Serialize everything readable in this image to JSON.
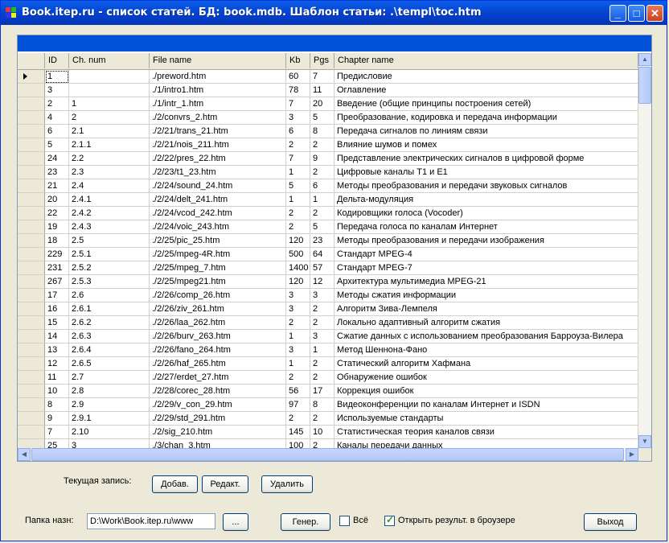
{
  "window": {
    "title": "Book.itep.ru - список статей.   БД: book.mdb.   Шаблон статьи: .\\templ\\toc.htm",
    "controls": {
      "minimize": "_",
      "maximize": "□",
      "close": "✕"
    }
  },
  "grid": {
    "columns": [
      "ID",
      "Ch. num",
      "File name",
      "Kb",
      "Pgs",
      "Chapter name"
    ],
    "rows": [
      [
        "1",
        "",
        "./preword.htm",
        "60",
        "7",
        "Предисловие"
      ],
      [
        "3",
        "",
        "./1/intro1.htm",
        "78",
        "11",
        "Оглавление"
      ],
      [
        "2",
        "1",
        "./1/intr_1.htm",
        "7",
        "20",
        "Введение (общие принципы построения сетей)"
      ],
      [
        "4",
        "2",
        "./2/convrs_2.htm",
        "3",
        "5",
        "Преобразование, кодировка и передача информации"
      ],
      [
        "6",
        "2.1",
        "./2/21/trans_21.htm",
        "6",
        "8",
        "Передача сигналов по линиям связи"
      ],
      [
        "5",
        "2.1.1",
        "./2/21/nois_211.htm",
        "2",
        "2",
        "Влияние шумов и помех"
      ],
      [
        "24",
        "2.2",
        "./2/22/pres_22.htm",
        "7",
        "9",
        "Представление электрических сигналов в цифровой форме"
      ],
      [
        "23",
        "2.3",
        "./2/23/t1_23.htm",
        "1",
        "2",
        "Цифровые каналы T1 и E1"
      ],
      [
        "21",
        "2.4",
        "./2/24/sound_24.htm",
        "5",
        "6",
        "Методы    преобразования и передачи звуковых сигналов"
      ],
      [
        "20",
        "2.4.1",
        "./2/24/delt_241.htm",
        "1",
        "1",
        "Дельта-модуляция"
      ],
      [
        "22",
        "2.4.2",
        "./2/24/vcod_242.htm",
        "2",
        "2",
        "Кодировщики голоса (Vocoder)"
      ],
      [
        "19",
        "2.4.3",
        "./2/24/voic_243.htm",
        "2",
        "5",
        "Передача голоса по каналам Интернет"
      ],
      [
        "18",
        "2.5",
        "./2/25/pic_25.htm",
        "120",
        "23",
        "Методы преобразования и передачи изображения"
      ],
      [
        "229",
        "2.5.1",
        "./2/25/mpeg-4R.htm",
        "500",
        "64",
        "Стандарт MPEG-4"
      ],
      [
        "231",
        "2.5.2",
        "./2/25/mpeg_7.htm",
        "1400",
        "57",
        "Стандарт MPEG-7"
      ],
      [
        "267",
        "2.5.3",
        "./2/25/mpeg21.htm",
        "120",
        "12",
        "Архитектура мультимедиа MPEG-21"
      ],
      [
        "17",
        "2.6",
        "./2/26/comp_26.htm",
        "3",
        "3",
        "Методы сжатия информации"
      ],
      [
        "16",
        "2.6.1",
        "./2/26/ziv_261.htm",
        "3",
        "2",
        "Алгоритм Зива-Лемпеля"
      ],
      [
        "15",
        "2.6.2",
        "./2/26/laa_262.htm",
        "2",
        "2",
        "Локально адаптивный алгоритм сжатия"
      ],
      [
        "14",
        "2.6.3",
        "./2/26/burv_263.htm",
        "1",
        "3",
        "Сжатие данных с использованием  преобразования Барроуза-Вилера"
      ],
      [
        "13",
        "2.6.4",
        "./2/26/fano_264.htm",
        "3",
        "1",
        "Метод Шеннона-Фано"
      ],
      [
        "12",
        "2.6.5",
        "./2/26/haf_265.htm",
        "1",
        "2",
        "Статический алгоритм Хафмана"
      ],
      [
        "11",
        "2.7",
        "./2/27/erdet_27.htm",
        "2",
        "2",
        "Обнаружение ошибок"
      ],
      [
        "10",
        "2.8",
        "./2/28/corec_28.htm",
        "56",
        "17",
        "Коррекция ошибок"
      ],
      [
        "8",
        "2.9",
        "./2/29/v_con_29.htm",
        "97",
        "8",
        "Видеоконференции    по каналам Интернет и ISDN"
      ],
      [
        "9",
        "2.9.1",
        "./2/29/std_291.htm",
        "2",
        "2",
        "Используемые стандарты"
      ],
      [
        "7",
        "2.10",
        "./2/sig_210.htm",
        "145",
        "10",
        "Статистическая теория каналов связи"
      ],
      [
        "25",
        "3",
        "./3/chan_3.htm",
        "100",
        "2",
        "Каналы передачи данных"
      ]
    ]
  },
  "record": {
    "label": "Текущая запись:",
    "add": "Добав.",
    "edit": "Редакт.",
    "delete": "Удалить"
  },
  "output": {
    "folder_label": "Папка назн:",
    "folder_value": "D:\\Work\\Book.itep.ru\\www",
    "browse": "...",
    "generate": "Генер.",
    "all_label": "Всё",
    "all_checked": false,
    "open_browser_label": "Открыть результ. в броузере",
    "open_browser_checked": true,
    "exit": "Выход"
  },
  "colors": {
    "title_bar": "#0542d0",
    "grid_band": "#0051d8",
    "checkmark": "#21a121"
  }
}
